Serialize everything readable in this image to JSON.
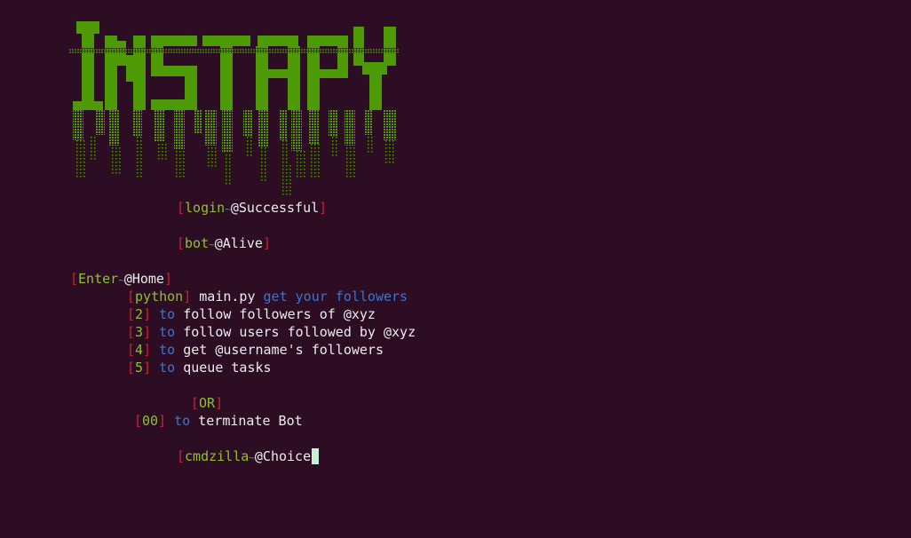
{
  "banner": {
    "text": "INSTAPY",
    "color": "#4e9a06"
  },
  "status": {
    "login": {
      "tag": "login",
      "sep": "~",
      "value": "@Successful"
    },
    "bot": {
      "tag": "bot",
      "sep": "~",
      "value": "@Alive"
    }
  },
  "menu": {
    "header": {
      "tag": "Enter",
      "sep": "~",
      "value": "@Home"
    },
    "python": {
      "tag": "python",
      "file": "main.py",
      "desc": "get your followers"
    },
    "items": [
      {
        "key": "2",
        "to": "to",
        "desc": "follow followers of @xyz"
      },
      {
        "key": "3",
        "to": "to",
        "desc": "follow users followed by @xyz"
      },
      {
        "key": "4",
        "to": "to",
        "desc": "get @username's followers"
      },
      {
        "key": "5",
        "to": "to",
        "desc": "queue tasks"
      }
    ],
    "or_label": "OR",
    "terminate": {
      "key": "00",
      "to": "to",
      "desc": "terminate Bot"
    }
  },
  "prompt": {
    "tag": "cmdzilla",
    "sep": "~",
    "value": "@Choice"
  },
  "colors": {
    "background": "#2d0d24",
    "bracket": "#c7232e",
    "tag_green": "#8ec02e",
    "text_white": "#ececec",
    "keyword_blue": "#3f74c8",
    "cursor": "#c8f0d8"
  }
}
